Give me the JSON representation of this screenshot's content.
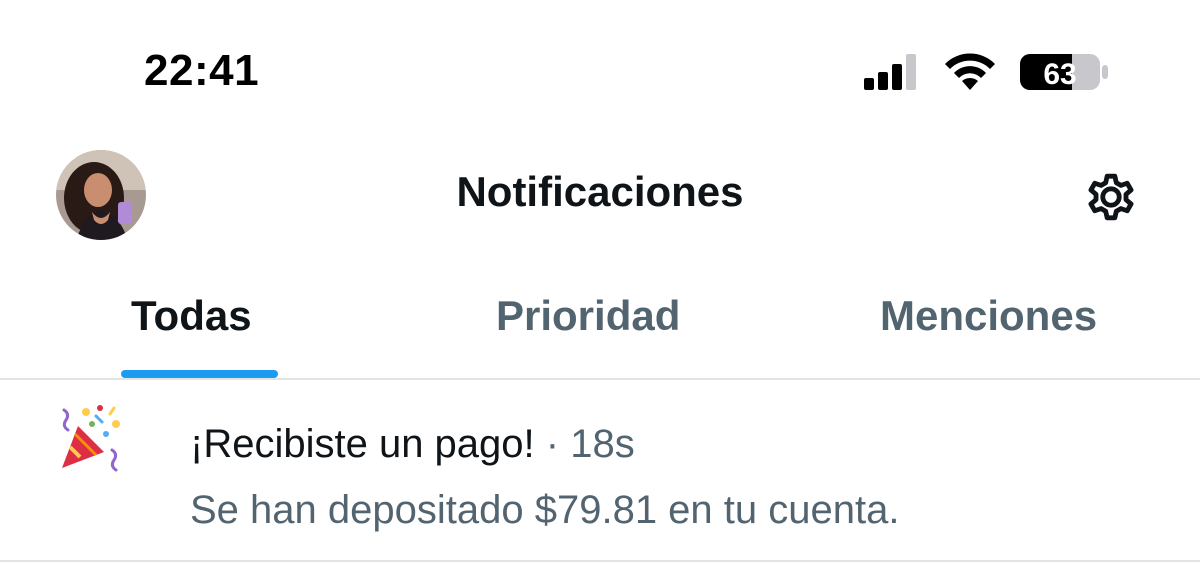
{
  "status_bar": {
    "time": "22:41",
    "battery_level": "63",
    "icons": [
      "cellular-signal-icon",
      "wifi-icon",
      "battery-icon"
    ]
  },
  "header": {
    "title": "Notificaciones",
    "settings_icon": "gear-icon"
  },
  "tabs": [
    {
      "label": "Todas",
      "active": true
    },
    {
      "label": "Prioridad",
      "active": false
    },
    {
      "label": "Menciones",
      "active": false
    }
  ],
  "notifications": [
    {
      "icon": "party-popper-icon",
      "title": "¡Recibiste un pago!",
      "separator": "·",
      "time": "18s",
      "body": "Se han depositado $79.81 en tu cuenta."
    }
  ],
  "colors": {
    "accent": "#1d9bf0",
    "text_primary": "#0f1419",
    "text_secondary": "#536471",
    "divider": "#e1e5e8"
  }
}
